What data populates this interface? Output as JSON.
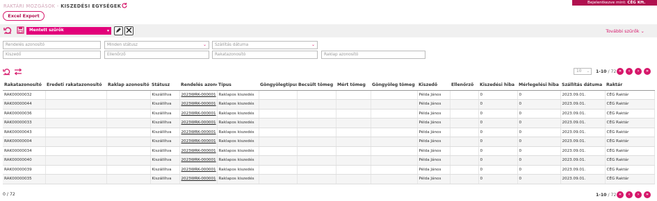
{
  "header": {
    "breadcrumb_parent": "RAKTÁRI MOZGÁSOK",
    "breadcrumb_sep": " - ",
    "breadcrumb_current": "KISZEDÉSI EGYSÉGEK",
    "login_prefix": "Bejelentkezve mint: ",
    "login_user": "CÉG Kft."
  },
  "toolbar": {
    "excel_label": "Excel Export",
    "saved_filters_label": "Mentett szűrők",
    "more_filters_label": "További szűrők"
  },
  "filters": {
    "order_id_placeholder": "Rendelés azonosító",
    "status_placeholder": "Minden státusz",
    "shipping_date_placeholder": "Szállítás dátuma",
    "picker_placeholder": "Kiszedő",
    "checker_placeholder": "Ellenőrző",
    "warehouse_id_placeholder": "Rakatazonosító",
    "pallet_id_placeholder": "Raklap azonosító"
  },
  "pagination": {
    "page_size": "10",
    "range": "1-10",
    "total": "72",
    "slash": " / "
  },
  "footer": {
    "count_left": "0",
    "count_total": "72"
  },
  "table": {
    "columns": [
      "Rakatazonosító",
      "Eredeti rakatazonosító",
      "Raklap azonosító",
      "Státusz",
      "Rendelés azonosító",
      "Típus",
      "Göngyölegtípus",
      "Becsült tömeg",
      "Mért tömeg",
      "Göngyöleg tömeg",
      "Kiszedő",
      "Ellenőrző",
      "Kiszedési hiba",
      "Mérlegelési hiba",
      "Szállítás dátuma",
      "Raktár"
    ],
    "rows": [
      [
        "RAK00000032",
        "",
        "",
        "Kiszállítva",
        "2023WRK-000001",
        "Raklapos kiszedés",
        "",
        "",
        "",
        "",
        "Példa János",
        "",
        "0",
        "0",
        "2023.09.01.",
        "CÉG Raktár"
      ],
      [
        "RAK00000044",
        "",
        "",
        "Kiszállítva",
        "2023WRK-000001",
        "Raklapos kiszedés",
        "",
        "",
        "",
        "",
        "Példa János",
        "",
        "0",
        "0",
        "2023.09.01.",
        "CÉG Raktár"
      ],
      [
        "RAK00000036",
        "",
        "",
        "Kiszállítva",
        "2023WRK-000001",
        "Raklapos kiszedés",
        "",
        "",
        "",
        "",
        "Példa János",
        "",
        "0",
        "0",
        "2023.09.01.",
        "CÉG Raktár"
      ],
      [
        "RAK00000033",
        "",
        "",
        "Kiszállítva",
        "2023WRK-000001",
        "Raklapos kiszedés",
        "",
        "",
        "",
        "",
        "Példa János",
        "",
        "0",
        "0",
        "2023.09.01.",
        "CÉG Raktár"
      ],
      [
        "RAK00000043",
        "",
        "",
        "Kiszállítva",
        "2023WRK-000001",
        "Raklapos kiszedés",
        "",
        "",
        "",
        "",
        "Példa János",
        "",
        "0",
        "0",
        "2023.09.01.",
        "CÉG Raktár"
      ],
      [
        "RAK00000004",
        "",
        "",
        "Kiszállítva",
        "2023WRK-000001",
        "Raklapos kiszedés",
        "",
        "",
        "",
        "",
        "Példa János",
        "",
        "0",
        "0",
        "2023.09.01.",
        "CÉG Raktár"
      ],
      [
        "RAK00000034",
        "",
        "",
        "Kiszállítva",
        "2023WRK-000001",
        "Raklapos kiszedés",
        "",
        "",
        "",
        "",
        "Példa János",
        "",
        "0",
        "0",
        "2023.09.01.",
        "CÉG Raktár"
      ],
      [
        "RAK00000040",
        "",
        "",
        "Kiszállítva",
        "2023WRK-000001",
        "Raklapos kiszedés",
        "",
        "",
        "",
        "",
        "Példa János",
        "",
        "0",
        "0",
        "2023.09.01.",
        "CÉG Raktár"
      ],
      [
        "RAK00000039",
        "",
        "",
        "Kiszállítva",
        "2023WRK-000001",
        "Raklapos kiszedés",
        "",
        "",
        "",
        "",
        "Példa János",
        "",
        "0",
        "0",
        "2023.09.01.",
        "CÉG Raktár"
      ],
      [
        "RAK00000035",
        "",
        "",
        "Kiszállítva",
        "2023WRK-000001",
        "Raklapos kiszedés",
        "",
        "",
        "",
        "",
        "Példa János",
        "",
        "0",
        "0",
        "2023.09.01.",
        "CÉG Raktár"
      ]
    ]
  },
  "colors": {
    "accent": "#d6186b",
    "brand_dark": "#b0104f",
    "saved_filter_bg": "#e2007a"
  },
  "icons": [
    "refresh-icon",
    "save-icon",
    "edit-pencil-icon",
    "clear-x-icon",
    "reset-icon",
    "swap-columns-icon",
    "chevron-down-icon",
    "first-page-icon",
    "prev-page-icon",
    "next-page-icon",
    "last-page-icon"
  ]
}
